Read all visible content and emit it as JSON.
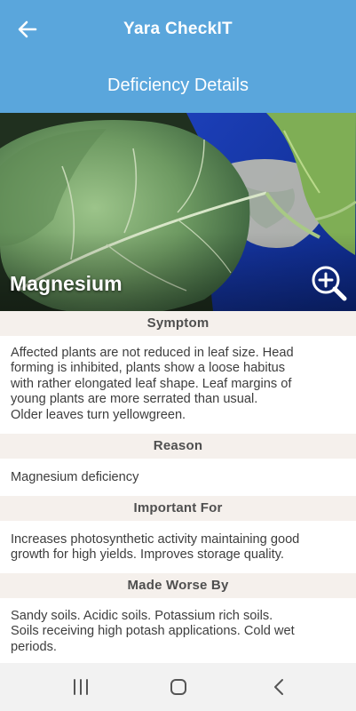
{
  "appbar": {
    "back_icon": "arrow-left-icon",
    "title": "Yara CheckIT",
    "subtitle": "Deficiency Details",
    "color": "#5aa6dc"
  },
  "hero": {
    "nutrient": "Magnesium",
    "zoom_icon": "zoom-in-icon"
  },
  "sections": {
    "symptom": {
      "header": "Symptom",
      "lines": [
        "Affected plants are not reduced in leaf size. Head",
        "forming is inhibited, plants show a loose habitus",
        "with rather elongated leaf shape. Leaf margins of",
        "young plants are more serrated than usual.",
        "Older leaves turn yellowgreen."
      ]
    },
    "reason": {
      "header": "Reason",
      "lines": [
        "Magnesium deficiency"
      ]
    },
    "important_for": {
      "header": "Important For",
      "lines": [
        "Increases photosynthetic activity maintaining good",
        "growth for high yields. Improves storage quality."
      ]
    },
    "made_worse_by": {
      "header": "Made Worse By",
      "lines": [
        "Sandy soils. Acidic soils. Potassium rich soils.",
        "Soils receiving high potash applications. Cold wet",
        "periods."
      ]
    }
  },
  "system_nav": {
    "recents_icon": "recents-icon",
    "home_icon": "home-icon",
    "back_icon": "back-chevron-icon"
  }
}
